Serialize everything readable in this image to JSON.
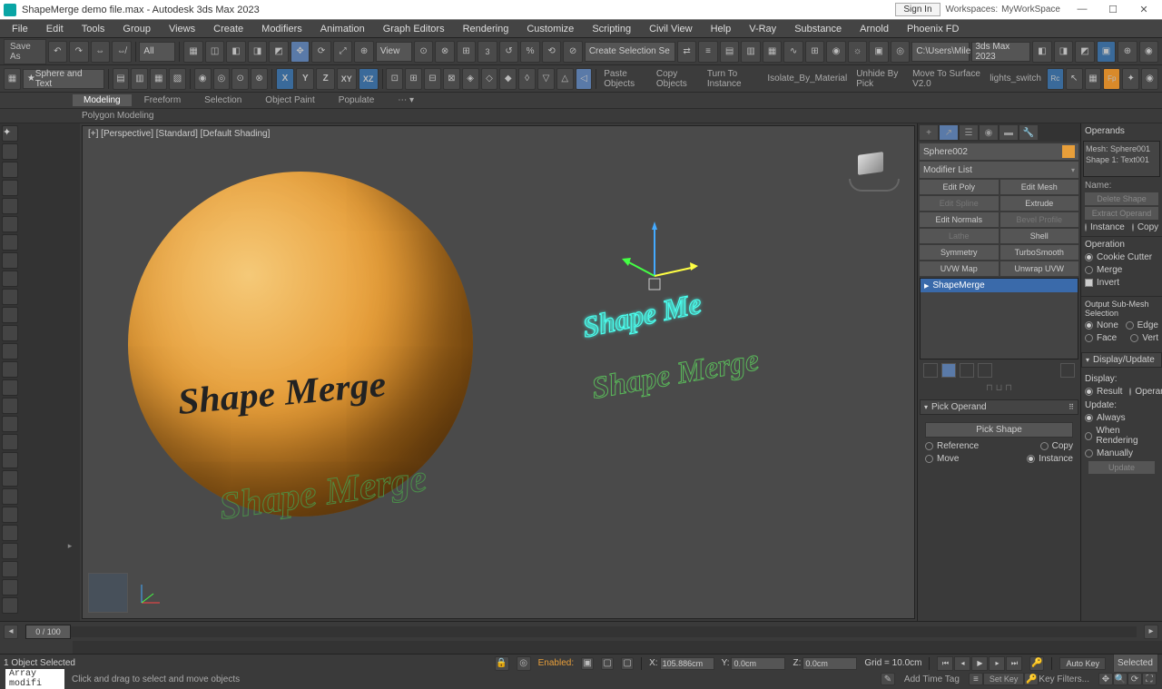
{
  "title": "ShapeMerge demo file.max - Autodesk 3ds Max 2023",
  "signin": "Sign In",
  "workspaces_label": "Workspaces:",
  "workspace_value": "MyWorkSpace",
  "menu": [
    "File",
    "Edit",
    "Tools",
    "Group",
    "Views",
    "Create",
    "Modifiers",
    "Animation",
    "Graph Editors",
    "Rendering",
    "Customize",
    "Scripting",
    "Civil View",
    "Help",
    "V-Ray",
    "Substance",
    "Arnold",
    "Phoenix FD"
  ],
  "saveas": "Save As",
  "selset": "Sphere and Text",
  "all_label": "All",
  "view_label": "View",
  "createsel": "Create Selection Se",
  "path_label": "C:\\Users\\Mile",
  "path_label2": "3ds Max 2023",
  "custom_btns": [
    "Paste Objects",
    "Copy Objects",
    "Turn To Instance",
    "Isolate_By_Material",
    "Unhide By Pick",
    "Move To Surface V2.0",
    "lights_switch"
  ],
  "ribbon_tabs": [
    "Modeling",
    "Freeform",
    "Selection",
    "Object Paint",
    "Populate"
  ],
  "subribbon": "Polygon Modeling",
  "viewport_label": "[+] [Perspective] [Standard] [Default Shading]",
  "sphere_text": "Shape Merge",
  "green_text1": "Shape Merge",
  "green_text2": "Shape Merge",
  "cyan_text": "Shape Me",
  "obj_name": "Sphere002",
  "modifier_list": "Modifier List",
  "mod_buttons": [
    {
      "l": "Edit Poly",
      "d": false
    },
    {
      "l": "Edit Mesh",
      "d": false
    },
    {
      "l": "Edit Spline",
      "d": true
    },
    {
      "l": "Extrude",
      "d": false
    },
    {
      "l": "Edit Normals",
      "d": false
    },
    {
      "l": "Bevel Profile",
      "d": true
    },
    {
      "l": "Lathe",
      "d": true
    },
    {
      "l": "Shell",
      "d": false
    },
    {
      "l": "Symmetry",
      "d": false
    },
    {
      "l": "TurboSmooth",
      "d": false
    },
    {
      "l": "UVW Map",
      "d": false
    },
    {
      "l": "Unwrap UVW",
      "d": false
    }
  ],
  "stack_item": "ShapeMerge",
  "rollout_pick": "Pick Operand",
  "pick_button": "Pick Shape",
  "pick_opts": {
    "reference": "Reference",
    "copy": "Copy",
    "move": "Move",
    "instance": "Instance"
  },
  "operands": {
    "title": "Operands",
    "list": [
      "Mesh: Sphere001",
      "Shape 1: Text001"
    ],
    "name_label": "Name:",
    "delete": "Delete Shape",
    "extract": "Extract Operand",
    "inst": "Instance",
    "copy": "Copy",
    "operation": "Operation",
    "cookie": "Cookie Cutter",
    "merge": "Merge",
    "invert": "Invert",
    "submesh": "Output Sub-Mesh Selection",
    "none": "None",
    "edge": "Edge",
    "face": "Face",
    "vert": "Vert",
    "display": "Display/Update",
    "disp_label": "Display:",
    "result": "Result",
    "oper": "Operands",
    "update": "Update:",
    "always": "Always",
    "rendering": "When Rendering",
    "manually": "Manually",
    "update_btn": "Update"
  },
  "timeline": "0 / 100",
  "status": {
    "selected": "1 Object Selected",
    "hint": "Click and drag to select and move objects",
    "cmd": "Array modifi",
    "x": "105.886cm",
    "y": "0.0cm",
    "z": "0.0cm",
    "grid": "Grid = 10.0cm",
    "addtag": "Add Time Tag",
    "autokey": "Auto Key",
    "setkey": "Set Key",
    "selected_filter": "Selected",
    "keyfilters": "Key Filters..."
  }
}
